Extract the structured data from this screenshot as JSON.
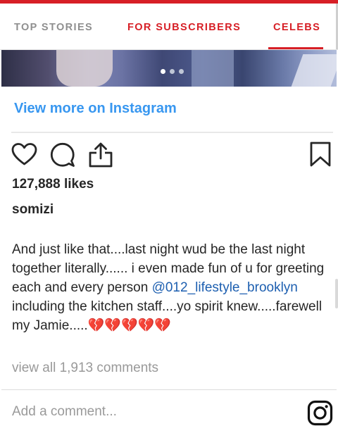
{
  "nav": {
    "tabs": [
      {
        "label": "TOP STORIES",
        "active": false
      },
      {
        "label": "FOR SUBSCRIBERS",
        "active": false
      },
      {
        "label": "CELEBS",
        "active": true
      }
    ]
  },
  "post": {
    "carousel": {
      "slide": 1,
      "total": 3
    },
    "view_more_label": "View more on Instagram",
    "likes": "127,888 likes",
    "username": "somizi",
    "caption_text": "And just like that....last night wud be the last night together literally...... i even made fun of u for greeting each and every person ",
    "caption_mention": "@012_lifestyle_brooklyn",
    "caption_text_2": " including the kitchen staff....yo spirit knew.....farewell my Jamie.....",
    "caption_emojis": "💔💔💔💔💔",
    "view_all_comments": "view all 1,913 comments",
    "comment_placeholder": "Add a comment..."
  },
  "colors": {
    "brand_red": "#d71f26",
    "instagram_blue": "#3897f0",
    "mention_blue": "#1d5fb0",
    "broken_heart": "#e0607e"
  },
  "icons": [
    "heart-icon",
    "comment-icon",
    "share-icon",
    "bookmark-icon",
    "instagram-logo-icon",
    "broken-heart-icon"
  ]
}
